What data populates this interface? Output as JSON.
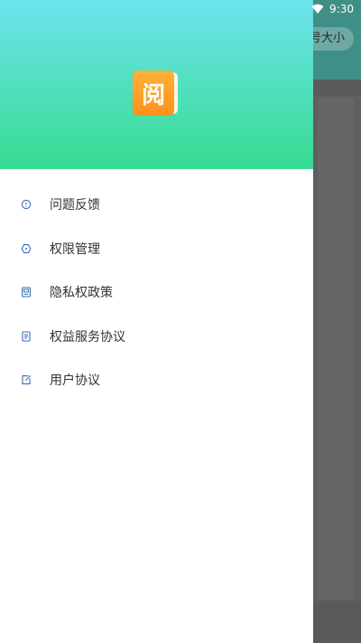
{
  "status_bar": {
    "time": "9:30"
  },
  "background_app": {
    "font_size_button_label": "号大小"
  },
  "drawer": {
    "logo_char": "阅",
    "menu_items": [
      {
        "label": "问题反馈",
        "icon": "feedback-icon"
      },
      {
        "label": "权限管理",
        "icon": "permission-icon"
      },
      {
        "label": "隐私权政策",
        "icon": "privacy-policy-icon"
      },
      {
        "label": "权益服务协议",
        "icon": "service-agreement-icon"
      },
      {
        "label": "用户协议",
        "icon": "user-agreement-icon"
      }
    ]
  },
  "colors": {
    "header_gradient_top": "#6de3ee",
    "header_gradient_bottom": "#37db90",
    "logo_orange": "#ff9a25",
    "icon_blue": "#3a6fb0"
  }
}
